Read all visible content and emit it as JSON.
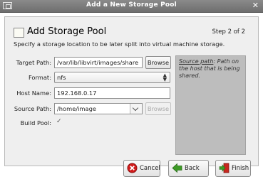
{
  "window": {
    "title": "Add a New Storage Pool",
    "close_symbol": "✕"
  },
  "header": {
    "title": "Add Storage Pool",
    "step": "Step 2 of 2",
    "subtitle": "Specify a storage location to be later split into virtual machine storage."
  },
  "form": {
    "target_path": {
      "label": "Target Path:",
      "value": "/var/lib/libvirt/images/share",
      "browse": "Browse"
    },
    "format": {
      "label": "Format:",
      "value": "nfs"
    },
    "host_name": {
      "label": "Host Name:",
      "value": "192.168.0.17"
    },
    "source_path": {
      "label": "Source Path:",
      "value": "/home/image",
      "browse": "Browse"
    },
    "build_pool": {
      "label": "Build Pool:",
      "checked": true,
      "mark": "✓"
    }
  },
  "help": {
    "term": "Source path",
    "text": ": Path on the host that is being shared."
  },
  "buttons": {
    "cancel": "Cancel",
    "back": "Back",
    "finish": "Finish"
  },
  "colors": {
    "title_bar": "#7a7a7a",
    "cancel_icon": "#d21b1b",
    "back_icon": "#3d9a26",
    "finish_icon": "#c8281e"
  }
}
